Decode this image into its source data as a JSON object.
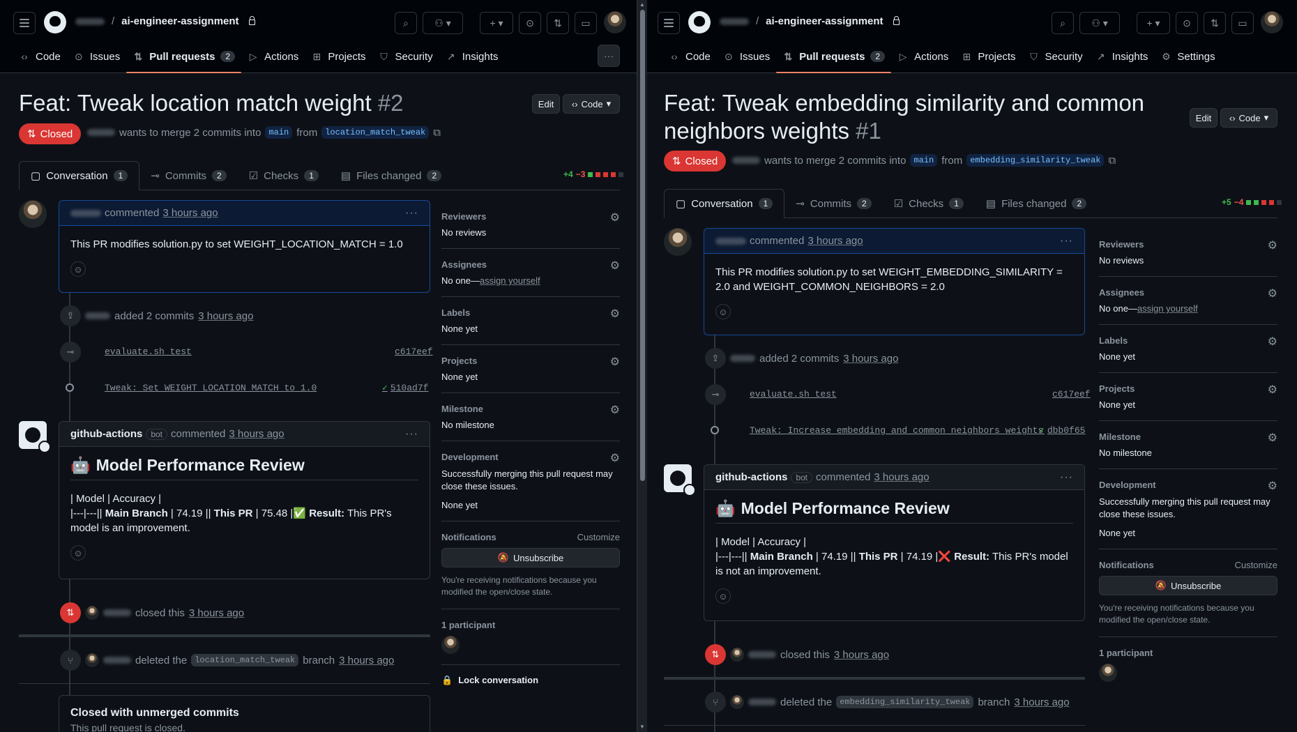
{
  "left": {
    "repo": "ai-engineer-assignment",
    "nav": [
      {
        "label": "Code",
        "icon": "code-icon"
      },
      {
        "label": "Issues",
        "icon": "issue-icon"
      },
      {
        "label": "Pull requests",
        "icon": "pull-request-icon",
        "count": "2"
      },
      {
        "label": "Actions",
        "icon": "play-icon"
      },
      {
        "label": "Projects",
        "icon": "table-icon"
      },
      {
        "label": "Security",
        "icon": "shield-icon"
      },
      {
        "label": "Insights",
        "icon": "graph-icon"
      }
    ],
    "more_label": "···",
    "title": "Feat: Tweak location match weight",
    "number": "#2",
    "edit_label": "Edit",
    "code_label": "Code",
    "status": "Closed",
    "meta_text": "wants to merge 2 commits into",
    "base_branch": "main",
    "from_text": "from",
    "head_branch": "location_match_tweak",
    "subtabs": [
      {
        "label": "Conversation",
        "count": "1"
      },
      {
        "label": "Commits",
        "count": "2"
      },
      {
        "label": "Checks",
        "count": "1"
      },
      {
        "label": "Files changed",
        "count": "2"
      }
    ],
    "diff_add": "+4",
    "diff_del": "−3",
    "comment1": {
      "action": "commented",
      "time": "3 hours ago",
      "body": "This PR modifies solution.py to set WEIGHT_LOCATION_MATCH = 1.0"
    },
    "added_commits": {
      "user": "vivek",
      "text": "added 2 commits",
      "time": "3 hours ago"
    },
    "commits": [
      {
        "message": "evaluate.sh test",
        "sha": "c617eef",
        "verified": false
      },
      {
        "message": "Tweak: Set WEIGHT_LOCATION_MATCH to 1.0",
        "sha": "510ad7f",
        "verified": true
      }
    ],
    "bot_comment": {
      "author": "github-actions",
      "bot": "bot",
      "action": "commented",
      "time": "3 hours ago",
      "heading": "Model Performance Review",
      "heading_emoji": "🤖",
      "line1": "| Model | Accuracy |",
      "line2_a": "|---|---|| ",
      "main_branch": "Main Branch",
      "line2_b": " | 74.19 || ",
      "this_pr": "This PR",
      "line2_c": " | 75.48 |",
      "result_emoji": "✅",
      "result": "Result:",
      "result_text": " This PR's model is an improvement."
    },
    "closed_event": {
      "text": "closed this",
      "time": "3 hours ago"
    },
    "deleted_event": {
      "text": "deleted the",
      "branch": "location_match_tweak",
      "suffix": "branch",
      "time": "3 hours ago"
    },
    "closed_box": {
      "title": "Closed with unmerged commits",
      "sub": "This pull request is closed."
    },
    "sidebar": {
      "reviewers": {
        "title": "Reviewers",
        "value": "No reviews"
      },
      "assignees": {
        "title": "Assignees",
        "value": "No one—",
        "link": "assign yourself"
      },
      "labels": {
        "title": "Labels",
        "value": "None yet"
      },
      "projects": {
        "title": "Projects",
        "value": "None yet"
      },
      "milestone": {
        "title": "Milestone",
        "value": "No milestone"
      },
      "development": {
        "title": "Development",
        "value": "Successfully merging this pull request may close these issues.",
        "value2": "None yet"
      },
      "notifications": {
        "title": "Notifications",
        "customize": "Customize",
        "button": "Unsubscribe",
        "note": "You're receiving notifications because you modified the open/close state."
      },
      "participants": {
        "title": "1 participant"
      },
      "lock": "Lock conversation"
    }
  },
  "right": {
    "repo": "ai-engineer-assignment",
    "nav": [
      {
        "label": "Code",
        "icon": "code-icon"
      },
      {
        "label": "Issues",
        "icon": "issue-icon"
      },
      {
        "label": "Pull requests",
        "icon": "pull-request-icon",
        "count": "2"
      },
      {
        "label": "Actions",
        "icon": "play-icon"
      },
      {
        "label": "Projects",
        "icon": "table-icon"
      },
      {
        "label": "Security",
        "icon": "shield-icon"
      },
      {
        "label": "Insights",
        "icon": "graph-icon"
      },
      {
        "label": "Settings",
        "icon": "gear-icon"
      }
    ],
    "title_line1": "Feat: Tweak embedding similarity and common",
    "title_line2": "neighbors weights",
    "number": "#1",
    "edit_label": "Edit",
    "code_label": "Code",
    "status": "Closed",
    "meta_text": "wants to merge 2 commits into",
    "base_branch": "main",
    "from_text": "from",
    "head_branch": "embedding_similarity_tweak",
    "subtabs": [
      {
        "label": "Conversation",
        "count": "1"
      },
      {
        "label": "Commits",
        "count": "2"
      },
      {
        "label": "Checks",
        "count": "1"
      },
      {
        "label": "Files changed",
        "count": "2"
      }
    ],
    "diff_add": "+5",
    "diff_del": "−4",
    "comment1": {
      "action": "commented",
      "time": "3 hours ago",
      "body": "This PR modifies solution.py to set WEIGHT_EMBEDDING_SIMILARITY = 2.0 and WEIGHT_COMMON_NEIGHBORS = 2.0"
    },
    "added_commits": {
      "user": "vivek",
      "text": "added 2 commits",
      "time": "3 hours ago"
    },
    "commits": [
      {
        "message": "evaluate.sh test",
        "sha": "c617eef",
        "verified": false
      },
      {
        "message": "Tweak: Increase embedding and common neighbors weights",
        "sha": "dbb0f65",
        "verified": true
      }
    ],
    "bot_comment": {
      "author": "github-actions",
      "bot": "bot",
      "action": "commented",
      "time": "3 hours ago",
      "heading": "Model Performance Review",
      "heading_emoji": "🤖",
      "line1": "| Model | Accuracy |",
      "line2_a": "|---|---|| ",
      "main_branch": "Main Branch",
      "line2_b": " | 74.19 || ",
      "this_pr": "This PR",
      "line2_c": " | 74.19 |",
      "result_emoji": "❌",
      "result": "Result:",
      "result_text": " This PR's model is not an improvement."
    },
    "closed_event": {
      "text": "closed this",
      "time": "3 hours ago"
    },
    "deleted_event": {
      "text": "deleted the",
      "branch": "embedding_similarity_tweak",
      "suffix": "branch",
      "time": "3 hours ago"
    },
    "sidebar": {
      "reviewers": {
        "title": "Reviewers",
        "value": "No reviews"
      },
      "assignees": {
        "title": "Assignees",
        "value": "No one—",
        "link": "assign yourself"
      },
      "labels": {
        "title": "Labels",
        "value": "None yet"
      },
      "projects": {
        "title": "Projects",
        "value": "None yet"
      },
      "milestone": {
        "title": "Milestone",
        "value": "No milestone"
      },
      "development": {
        "title": "Development",
        "value": "Successfully merging this pull request may close these issues.",
        "value2": "None yet"
      },
      "notifications": {
        "title": "Notifications",
        "customize": "Customize",
        "button": "Unsubscribe",
        "note": "You're receiving notifications because you modified the open/close state."
      },
      "participants": {
        "title": "1 participant"
      }
    }
  },
  "colors": {
    "closed": "#da3633",
    "accent": "#f78166",
    "link": "#79c0ff",
    "add": "#3fb950",
    "del": "#f85149"
  }
}
